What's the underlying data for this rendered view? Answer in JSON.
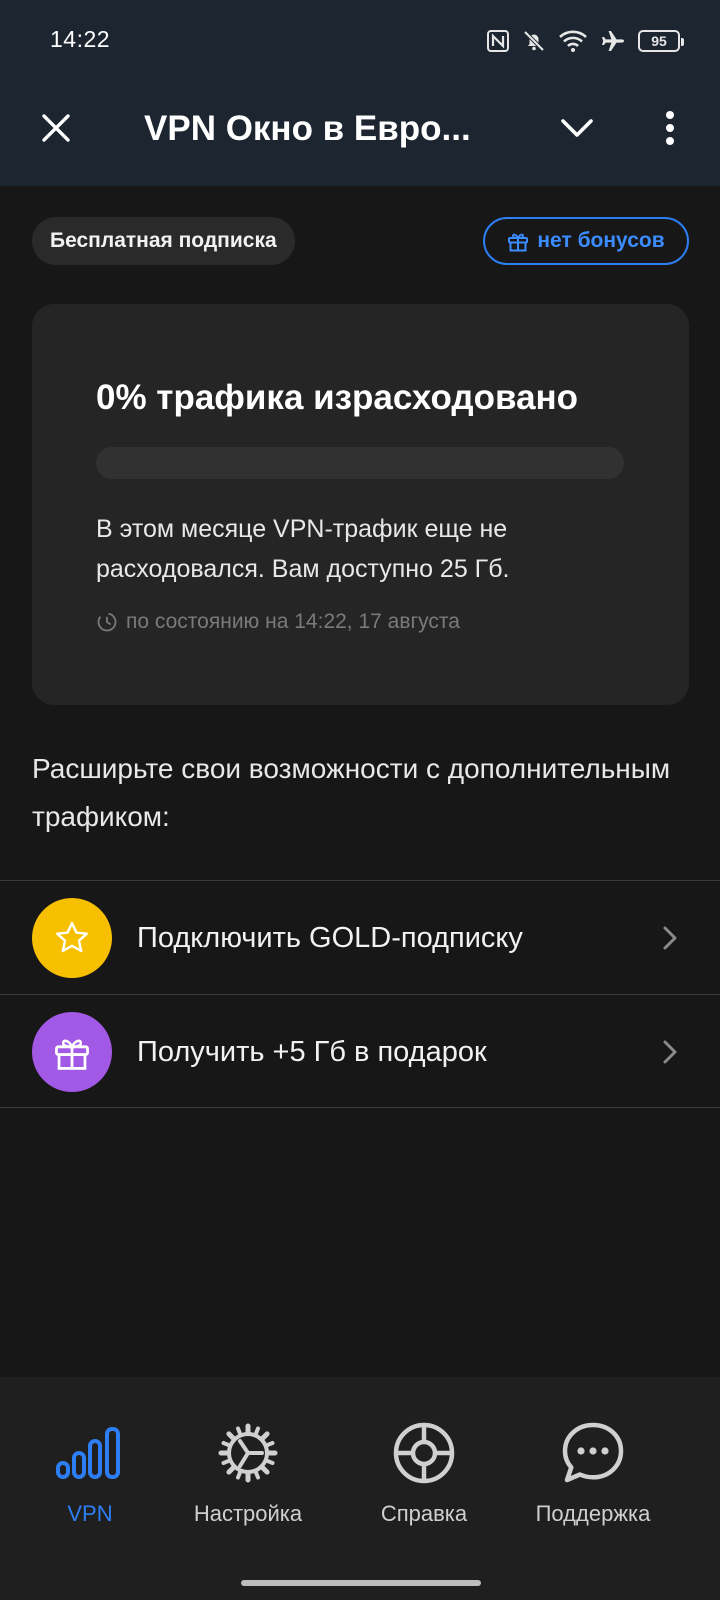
{
  "status_bar": {
    "time": "14:22",
    "battery": "95",
    "icons": [
      "nfc-icon",
      "bell-off-icon",
      "wifi-icon",
      "airplane-icon",
      "battery-icon"
    ]
  },
  "header": {
    "title": "VPN Окно в Евро...",
    "icons": [
      "close-icon",
      "chevron-down-icon",
      "more-vertical-icon"
    ]
  },
  "subscription": {
    "plan_label": "Бесплатная подписка",
    "bonus_label": "нет бонусов",
    "bonus_icon": "gift-icon"
  },
  "traffic": {
    "title": "0% трафика израсходовано",
    "used_percent": 0,
    "description": "В этом месяце VPN-трафик еще не расходовался. Вам доступно 25 Гб.",
    "updated": "по состоянию на 14:22, 17 августа",
    "updated_icon": "timer-icon"
  },
  "promo": {
    "text": "Расширьте свои возможности с дополнительным трафиком:"
  },
  "options": [
    {
      "label": "Подключить GOLD-подписку",
      "icon": "star-icon",
      "color": "#f6c000"
    },
    {
      "label": "Получить +5 Гб в подарок",
      "icon": "gift-icon",
      "color": "#a259e6"
    }
  ],
  "bottom_nav": [
    {
      "label": "VPN",
      "icon": "signal-bars-icon",
      "active": true
    },
    {
      "label": "Настройка",
      "icon": "gear-icon",
      "active": false
    },
    {
      "label": "Справка",
      "icon": "lifebuoy-icon",
      "active": false
    },
    {
      "label": "Поддержка",
      "icon": "chat-bubble-icon",
      "active": false
    }
  ],
  "colors": {
    "accent": "#2d7ef2",
    "background": "#171717",
    "header_bg": "#1c2530",
    "card_bg": "#252525"
  }
}
